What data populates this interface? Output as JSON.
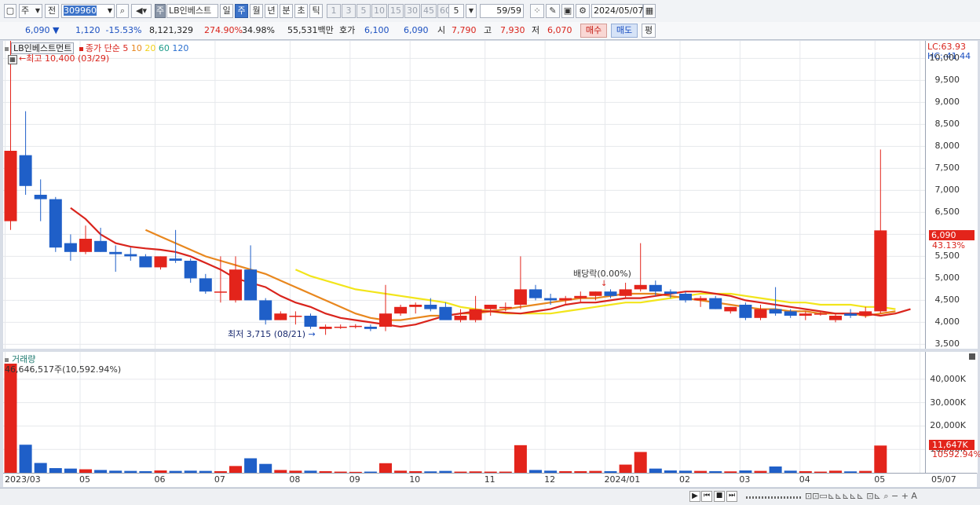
{
  "toolbar": {
    "period_type": "주",
    "compare": "전",
    "code": "309960",
    "stock_badge": "주",
    "stock_name": "LB인베스트",
    "tabs": [
      "일",
      "주",
      "월",
      "년",
      "분",
      "초",
      "틱"
    ],
    "active_tab": "주",
    "intervals": [
      "1",
      "3",
      "5",
      "10",
      "15",
      "30",
      "45",
      "60"
    ],
    "count_value": "5",
    "page": "59/59",
    "date": "2024/05/07"
  },
  "quote": {
    "price": "6,090",
    "direction": "▼",
    "change": "1,120",
    "change_pct": "-15.53%",
    "volume": "8,121,329",
    "volume_ratio": "274.90%",
    "turnover": "34.98%",
    "amount": "55,531백만",
    "ask_label": "호가",
    "ask": "6,100",
    "bid": "6,090",
    "open_label": "시",
    "open": "7,790",
    "high_label": "고",
    "high": "7,930",
    "low_label": "저",
    "low": "6,070",
    "buy": "매수",
    "sell": "매도",
    "eval": "평"
  },
  "legend": {
    "name": "LB인베스트먼트",
    "ma_label": "종가 단순",
    "periods": [
      "5",
      "10",
      "20",
      "60",
      "120"
    ],
    "colors": [
      "#d9241c",
      "#e8871e",
      "#f2d21b",
      "#1e9c8a",
      "#2a6fcf"
    ],
    "max_label": "최고 10,400 (03/29)",
    "min_label": "최저 3,715 (08/21)",
    "div_label": "배당락(0.00%)",
    "lc": "LC:63.93",
    "hc": "HC:-41.44",
    "cur_price": "6,090",
    "cur_pct": "43.13%"
  },
  "volume_panel": {
    "title": "거래량",
    "max_label": "46,646,517주(10,592.94%)",
    "cur": "11,647K",
    "cur_pct": "10592.94%"
  },
  "chart_data": {
    "type": "candlestick",
    "interval": "weekly",
    "ylim": [
      3400,
      10400
    ],
    "y_ticks": [
      "3,500",
      "4,000",
      "4,500",
      "5,000",
      "5,500",
      "6,000",
      "6,500",
      "7,000",
      "7,500",
      "8,000",
      "8,500",
      "9,000",
      "9,500",
      "10,000"
    ],
    "y_tick_values": [
      3500,
      4000,
      4500,
      5000,
      5500,
      6000,
      6500,
      7000,
      7500,
      8000,
      8500,
      9000,
      9500,
      10000
    ],
    "vol_ticks": [
      "10,000K",
      "20,000K",
      "30,000K",
      "40,000K"
    ],
    "vol_tick_values": [
      10000,
      20000,
      30000,
      40000
    ],
    "vol_max": 49000,
    "x_labels": [
      {
        "i": 0,
        "t": "2023/03"
      },
      {
        "i": 5,
        "t": "05"
      },
      {
        "i": 10,
        "t": "06"
      },
      {
        "i": 14,
        "t": "07"
      },
      {
        "i": 19,
        "t": "08"
      },
      {
        "i": 23,
        "t": "09"
      },
      {
        "i": 27,
        "t": "10"
      },
      {
        "i": 32,
        "t": "11"
      },
      {
        "i": 36,
        "t": "12"
      },
      {
        "i": 40,
        "t": "2024/01"
      },
      {
        "i": 45,
        "t": "02"
      },
      {
        "i": 49,
        "t": "03"
      },
      {
        "i": 53,
        "t": "04"
      },
      {
        "i": 58,
        "t": "05"
      },
      {
        "i": 61,
        "t": "05/07"
      }
    ],
    "candles": [
      {
        "o": 6300,
        "h": 10400,
        "l": 6100,
        "c": 7900,
        "v": 46647
      },
      {
        "o": 7800,
        "h": 8800,
        "l": 6900,
        "c": 7100,
        "v": 12000
      },
      {
        "o": 6900,
        "h": 7250,
        "l": 6300,
        "c": 6800,
        "v": 4200
      },
      {
        "o": 6800,
        "h": 6850,
        "l": 5600,
        "c": 5700,
        "v": 2000
      },
      {
        "o": 5800,
        "h": 6000,
        "l": 5400,
        "c": 5600,
        "v": 1800
      },
      {
        "o": 5600,
        "h": 6200,
        "l": 5550,
        "c": 5900,
        "v": 1500
      },
      {
        "o": 5850,
        "h": 6150,
        "l": 5600,
        "c": 5600,
        "v": 1200
      },
      {
        "o": 5600,
        "h": 5750,
        "l": 5150,
        "c": 5550,
        "v": 900
      },
      {
        "o": 5550,
        "h": 5700,
        "l": 5400,
        "c": 5500,
        "v": 800
      },
      {
        "o": 5500,
        "h": 5550,
        "l": 5300,
        "c": 5250,
        "v": 700
      },
      {
        "o": 5250,
        "h": 5500,
        "l": 5200,
        "c": 5500,
        "v": 1000
      },
      {
        "o": 5450,
        "h": 6100,
        "l": 5350,
        "c": 5400,
        "v": 800
      },
      {
        "o": 5400,
        "h": 5450,
        "l": 4900,
        "c": 5000,
        "v": 900
      },
      {
        "o": 5000,
        "h": 5100,
        "l": 4650,
        "c": 4700,
        "v": 800
      },
      {
        "o": 4700,
        "h": 5500,
        "l": 4450,
        "c": 4700,
        "v": 700
      },
      {
        "o": 4500,
        "h": 5500,
        "l": 4450,
        "c": 5200,
        "v": 2900
      },
      {
        "o": 5200,
        "h": 5750,
        "l": 4500,
        "c": 4500,
        "v": 6200
      },
      {
        "o": 4500,
        "h": 4550,
        "l": 3950,
        "c": 4050,
        "v": 3800
      },
      {
        "o": 4050,
        "h": 4250,
        "l": 4050,
        "c": 4200,
        "v": 1200
      },
      {
        "o": 4150,
        "h": 4250,
        "l": 3950,
        "c": 4150,
        "v": 900
      },
      {
        "o": 4150,
        "h": 4200,
        "l": 3850,
        "c": 3900,
        "v": 900
      },
      {
        "o": 3850,
        "h": 3950,
        "l": 3715,
        "c": 3900,
        "v": 700
      },
      {
        "o": 3900,
        "h": 3950,
        "l": 3850,
        "c": 3900,
        "v": 500
      },
      {
        "o": 3900,
        "h": 3960,
        "l": 3860,
        "c": 3920,
        "v": 400
      },
      {
        "o": 3900,
        "h": 3950,
        "l": 3800,
        "c": 3850,
        "v": 500
      },
      {
        "o": 3900,
        "h": 4850,
        "l": 3800,
        "c": 4200,
        "v": 4100
      },
      {
        "o": 4200,
        "h": 4400,
        "l": 4150,
        "c": 4350,
        "v": 900
      },
      {
        "o": 4350,
        "h": 4450,
        "l": 4200,
        "c": 4400,
        "v": 700
      },
      {
        "o": 4400,
        "h": 4550,
        "l": 4250,
        "c": 4300,
        "v": 600
      },
      {
        "o": 4350,
        "h": 4450,
        "l": 4100,
        "c": 4050,
        "v": 800
      },
      {
        "o": 4050,
        "h": 4300,
        "l": 4000,
        "c": 4150,
        "v": 500
      },
      {
        "o": 4050,
        "h": 4600,
        "l": 4000,
        "c": 4300,
        "v": 600
      },
      {
        "o": 4300,
        "h": 4400,
        "l": 4150,
        "c": 4400,
        "v": 500
      },
      {
        "o": 4350,
        "h": 4450,
        "l": 4250,
        "c": 4350,
        "v": 500
      },
      {
        "o": 4400,
        "h": 5500,
        "l": 4300,
        "c": 4750,
        "v": 11800
      },
      {
        "o": 4750,
        "h": 4850,
        "l": 4500,
        "c": 4550,
        "v": 1200
      },
      {
        "o": 4550,
        "h": 4650,
        "l": 4400,
        "c": 4500,
        "v": 900
      },
      {
        "o": 4500,
        "h": 4600,
        "l": 4400,
        "c": 4550,
        "v": 700
      },
      {
        "o": 4550,
        "h": 4700,
        "l": 4450,
        "c": 4600,
        "v": 700
      },
      {
        "o": 4600,
        "h": 4700,
        "l": 4500,
        "c": 4700,
        "v": 800
      },
      {
        "o": 4700,
        "h": 4750,
        "l": 4550,
        "c": 4600,
        "v": 700
      },
      {
        "o": 4600,
        "h": 4900,
        "l": 4550,
        "c": 4750,
        "v": 3500
      },
      {
        "o": 4750,
        "h": 5800,
        "l": 4700,
        "c": 4850,
        "v": 8900
      },
      {
        "o": 4850,
        "h": 4950,
        "l": 4600,
        "c": 4700,
        "v": 1800
      },
      {
        "o": 4700,
        "h": 4750,
        "l": 4550,
        "c": 4650,
        "v": 1000
      },
      {
        "o": 4650,
        "h": 4700,
        "l": 4450,
        "c": 4500,
        "v": 900
      },
      {
        "o": 4500,
        "h": 4600,
        "l": 4350,
        "c": 4550,
        "v": 800
      },
      {
        "o": 4550,
        "h": 4600,
        "l": 4300,
        "c": 4300,
        "v": 700
      },
      {
        "o": 4250,
        "h": 4350,
        "l": 4200,
        "c": 4350,
        "v": 600
      },
      {
        "o": 4400,
        "h": 4450,
        "l": 4050,
        "c": 4100,
        "v": 1000
      },
      {
        "o": 4100,
        "h": 4400,
        "l": 4050,
        "c": 4300,
        "v": 800
      },
      {
        "o": 4300,
        "h": 4800,
        "l": 4150,
        "c": 4200,
        "v": 2700
      },
      {
        "o": 4250,
        "h": 4300,
        "l": 4100,
        "c": 4150,
        "v": 900
      },
      {
        "o": 4150,
        "h": 4250,
        "l": 4050,
        "c": 4200,
        "v": 700
      },
      {
        "o": 4200,
        "h": 4250,
        "l": 4150,
        "c": 4200,
        "v": 500
      },
      {
        "o": 4050,
        "h": 4200,
        "l": 4000,
        "c": 4150,
        "v": 900
      },
      {
        "o": 4200,
        "h": 4300,
        "l": 4100,
        "c": 4150,
        "v": 600
      },
      {
        "o": 4150,
        "h": 4350,
        "l": 4100,
        "c": 4250,
        "v": 800
      },
      {
        "o": 4250,
        "h": 7930,
        "l": 4200,
        "c": 6090,
        "v": 11647
      }
    ],
    "ma": {
      "5": {
        "start": 4,
        "values": [
          6600,
          6350,
          6000,
          5800,
          5720,
          5680,
          5650,
          5600,
          5500,
          5350,
          5200,
          5000,
          4900,
          4800,
          4600,
          4450,
          4350,
          4200,
          4100,
          4050,
          4000,
          3950,
          3900,
          3950,
          4050,
          4150,
          4200,
          4250,
          4250,
          4220,
          4200,
          4250,
          4300,
          4400,
          4450,
          4450,
          4500,
          4550,
          4550,
          4600,
          4650,
          4700,
          4700,
          4650,
          4600,
          4500,
          4450,
          4400,
          4350,
          4300,
          4250,
          4200,
          4200,
          4200,
          4150,
          4200,
          4300
        ]
      },
      "10": {
        "start": 9,
        "values": [
          6100,
          5950,
          5800,
          5650,
          5500,
          5400,
          5300,
          5200,
          5100,
          4950,
          4800,
          4650,
          4500,
          4350,
          4200,
          4100,
          4050,
          4050,
          4100,
          4150,
          4150,
          4200,
          4200,
          4250,
          4300,
          4350,
          4400,
          4450,
          4500,
          4550,
          4550,
          4600,
          4650,
          4650,
          4650,
          4600,
          4550,
          4500,
          4450,
          4400,
          4350,
          4300,
          4300,
          4250,
          4250,
          4200,
          4200,
          4200,
          4150,
          4200,
          4250
        ]
      },
      "20": {
        "start": 19,
        "values": [
          5200,
          5050,
          4950,
          4850,
          4750,
          4700,
          4650,
          4600,
          4550,
          4500,
          4450,
          4350,
          4300,
          4250,
          4200,
          4200,
          4200,
          4200,
          4250,
          4300,
          4350,
          4400,
          4450,
          4450,
          4500,
          4550,
          4600,
          4650,
          4650,
          4650,
          4600,
          4550,
          4500,
          4450,
          4450,
          4400,
          4400,
          4400,
          4350,
          4350,
          4300
        ]
      }
    }
  }
}
